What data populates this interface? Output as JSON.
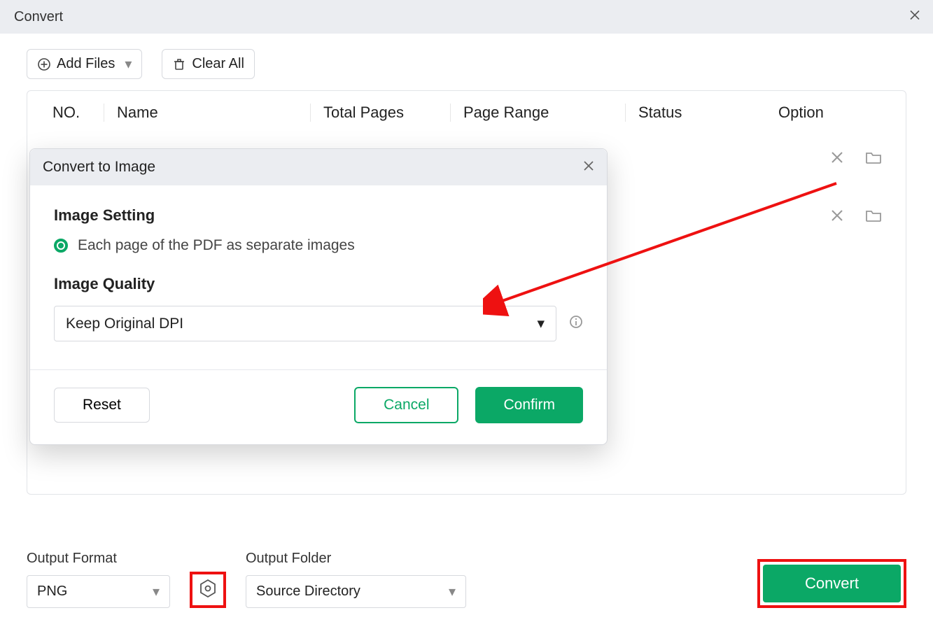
{
  "window": {
    "title": "Convert"
  },
  "toolbar": {
    "add_files_label": "Add Files",
    "clear_all_label": "Clear All"
  },
  "table": {
    "headers": {
      "no": "NO.",
      "name": "Name",
      "total_pages": "Total Pages",
      "page_range": "Page Range",
      "status": "Status",
      "option": "Option"
    }
  },
  "modal": {
    "title": "Convert to Image",
    "image_setting_heading": "Image Setting",
    "radio_label": "Each page of the PDF as separate images",
    "image_quality_heading": "Image Quality",
    "quality_selected": "Keep Original DPI",
    "reset_label": "Reset",
    "cancel_label": "Cancel",
    "confirm_label": "Confirm"
  },
  "bottom": {
    "output_format_label": "Output Format",
    "output_format_value": "PNG",
    "output_folder_label": "Output Folder",
    "output_folder_value": "Source Directory",
    "convert_label": "Convert"
  }
}
